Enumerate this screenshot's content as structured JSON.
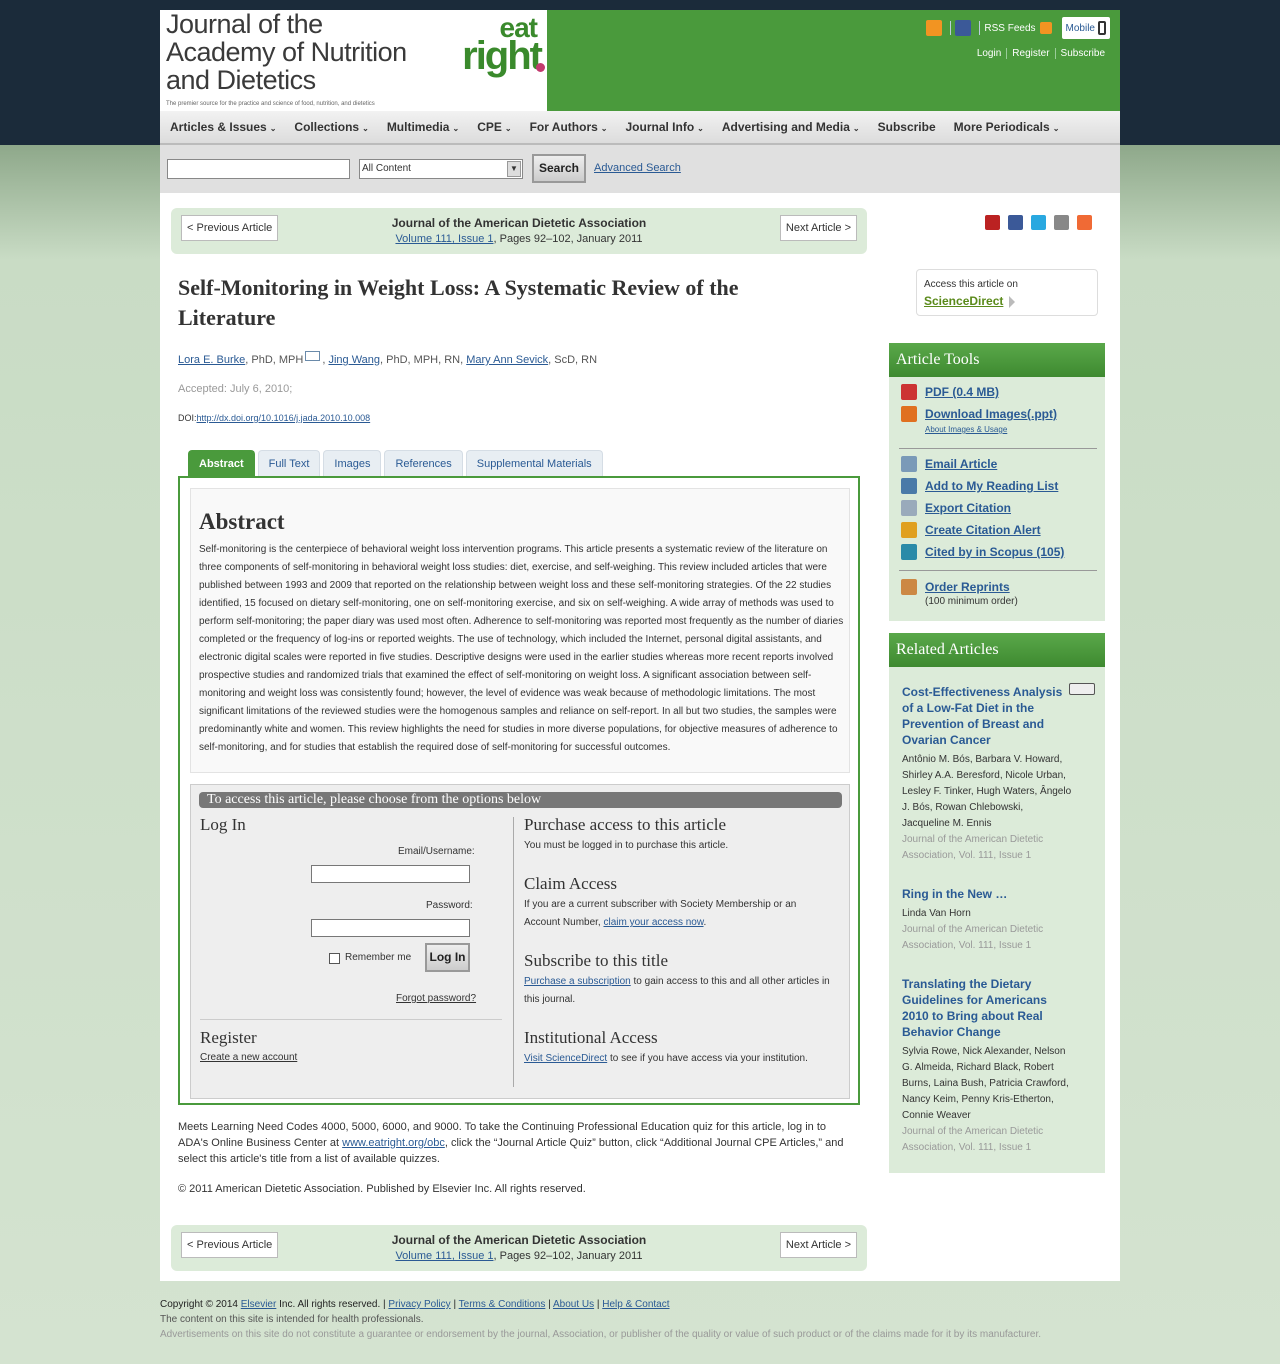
{
  "header": {
    "logo_line1": "Journal of the",
    "logo_line2": "Academy of Nutrition",
    "logo_line3": "and Dietetics",
    "logo_tagline": "The premier source for the practice and science of food, nutrition, and dietetics",
    "eatright_eat": "eat",
    "eatright_right": "right",
    "rss_label": "RSS Feeds",
    "mobile_label": "Mobile",
    "login": "Login",
    "register": "Register",
    "subscribe": "Subscribe"
  },
  "nav": {
    "items": [
      {
        "label": "Articles & Issues",
        "chev": "⌄"
      },
      {
        "label": "Collections",
        "chev": "⌄"
      },
      {
        "label": "Multimedia",
        "chev": "⌄"
      },
      {
        "label": "CPE",
        "chev": "⌄"
      },
      {
        "label": "For Authors",
        "chev": "⌄"
      },
      {
        "label": "Journal Info",
        "chev": "⌄"
      },
      {
        "label": "Advertising and Media",
        "chev": "⌄"
      },
      {
        "label": "Subscribe",
        "chev": ""
      },
      {
        "label": "More Periodicals",
        "chev": "⌄"
      }
    ]
  },
  "search": {
    "value": "",
    "select_value": "All Content",
    "button": "Search",
    "advanced": "Advanced Search"
  },
  "article_nav": {
    "prev": "< Previous Article",
    "next": "Next Article >",
    "journal": "Journal of the American Dietetic Association",
    "volume_link": "Volume 111, Issue 1",
    "pages": ", Pages 92–102, January 2011"
  },
  "article": {
    "title": "Self-Monitoring in Weight Loss: A Systematic Review of the Literature",
    "author1": "Lora E. Burke",
    "author1_cred": ", PhD, MPH",
    "author2": "Jing Wang",
    "author2_cred": ", PhD, MPH, RN, ",
    "author3": "Mary Ann Sevick",
    "author3_cred": ", ScD, RN",
    "accepted": "Accepted: July 6, 2010;",
    "doi_label": "DOI:",
    "doi_link": "http://dx.doi.org/10.1016/j.jada.2010.10.008"
  },
  "tabs": [
    "Abstract",
    "Full Text",
    "Images",
    "References",
    "Supplemental Materials"
  ],
  "abstract": {
    "heading": "Abstract",
    "text": "Self-monitoring is the centerpiece of behavioral weight loss intervention programs. This article presents a systematic review of the literature on three components of self-monitoring in behavioral weight loss studies: diet, exercise, and self-weighing. This review included articles that were published between 1993 and 2009 that reported on the relationship between weight loss and these self-monitoring strategies. Of the 22 studies identified, 15 focused on dietary self-monitoring, one on self-monitoring exercise, and six on self-weighing. A wide array of methods was used to perform self-monitoring; the paper diary was used most often. Adherence to self-monitoring was reported most frequently as the number of diaries completed or the frequency of log-ins or reported weights. The use of technology, which included the Internet, personal digital assistants, and electronic digital scales were reported in five studies. Descriptive designs were used in the earlier studies whereas more recent reports involved prospective studies and randomized trials that examined the effect of self-monitoring on weight loss. A significant association between self-monitoring and weight loss was consistently found; however, the level of evidence was weak because of methodologic limitations. The most significant limitations of the reviewed studies were the homogenous samples and reliance on self-report. In all but two studies, the samples were predominantly white and women. This review highlights the need for studies in more diverse populations, for objective measures of adherence to self-monitoring, and for studies that establish the required dose of self-monitoring for successful outcomes."
  },
  "access": {
    "header": "To access this article, please choose from the options below",
    "login_heading": "Log In",
    "email_label": "Email/Username:",
    "password_label": "Password:",
    "remember": "Remember me",
    "login_button": "Log In",
    "forgot": "Forgot password?",
    "register_heading": "Register",
    "create_account": "Create a new account",
    "purchase_heading": "Purchase access to this article",
    "purchase_text": "You must be logged in to purchase this article.",
    "claim_heading": "Claim Access",
    "claim_text": "If you are a current subscriber with Society Membership or an Account Number, ",
    "claim_link": "claim your access now",
    "claim_end": ".",
    "subscribe_heading": "Subscribe to this title",
    "subscribe_link": "Purchase a subscription",
    "subscribe_text": " to gain access to this and all other articles in this journal.",
    "inst_heading": "Institutional Access",
    "inst_link": "Visit ScienceDirect",
    "inst_text": " to see if you have access via your institution."
  },
  "cpe": {
    "text1": "Meets Learning Need Codes 4000, 5000, 6000, and 9000. To take the Continuing Professional Education quiz for this article, log in to ADA's Online Business Center at ",
    "link": "www.eatright.org/obc",
    "text2": ", click the “Journal Article Quiz” button, click “Additional Journal CPE Articles,” and select this article's title from a list of available quizzes."
  },
  "article_copyright": "© 2011 American Dietetic Association. Published by Elsevier Inc. All rights reserved.",
  "sciencedirect": {
    "access_text": "Access this article on",
    "link": "ScienceDirect"
  },
  "article_tools": {
    "heading": "Article Tools",
    "pdf": "PDF (0.4 MB)",
    "download_images": "Download Images(.ppt)",
    "about_images": "About Images & Usage",
    "email": "Email Article",
    "reading_list": "Add to My Reading List",
    "export": "Export Citation",
    "alert": "Create Citation Alert",
    "scopus": "Cited by in Scopus (105)",
    "reprints": "Order Reprints",
    "reprints_note": "(100 minimum order)"
  },
  "related": {
    "heading": "Related Articles",
    "items": [
      {
        "title": "Cost-Effectiveness Analysis of a Low-Fat Diet in the Prevention of Breast and Ovarian Cancer",
        "authors": "Antônio M. Bós, Barbara V. Howard, Shirley A.A. Beresford, Nicole Urban, Lesley F. Tinker, Hugh Waters, Ângelo J. Bós, Rowan Chlebowski, Jacqueline M. Ennis",
        "source": "Journal of the American Dietetic Association, Vol. 111, Issue 1"
      },
      {
        "title": "Ring in the New …",
        "authors": "Linda Van Horn",
        "source": "Journal of the American Dietetic Association, Vol. 111, Issue 1"
      },
      {
        "title": "Translating the Dietary Guidelines for Americans 2010 to Bring about Real Behavior Change",
        "authors": "Sylvia Rowe, Nick Alexander, Nelson G. Almeida, Richard Black, Robert Burns, Laina Bush, Patricia Crawford, Nancy Keim, Penny Kris-Etherton, Connie Weaver",
        "source": "Journal of the American Dietetic Association, Vol. 111, Issue 1"
      }
    ]
  },
  "footer": {
    "copyright": "Copyright © 2014 ",
    "elsevier": "Elsevier",
    "rights": " Inc. All rights reserved. | ",
    "privacy": "Privacy Policy",
    "terms": "Terms & Conditions",
    "about": "About Us",
    "help": "Help & Contact",
    "pipe": " | ",
    "line2": "The content on this site is intended for health professionals.",
    "line3": "Advertisements on this site do not constitute a guarantee or endorsement by the journal, Association, or publisher of the quality or value of such product or of the claims made for it by its manufacturer."
  },
  "colors": {
    "brand_green": "#4a9a3c",
    "header_dark": "#1b2b3a",
    "link_blue": "#2a5a94",
    "accent_magenta": "#c23a6e"
  }
}
